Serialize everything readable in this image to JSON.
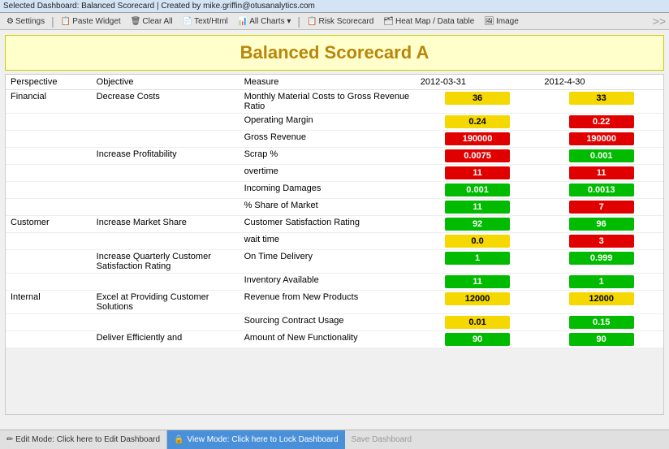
{
  "topbar": {
    "text": "Selected Dashboard: Balanced Scorecard | Created by mike.griffin@otusanalytics.com"
  },
  "toolbar": {
    "items": [
      {
        "label": "Settings",
        "icon": "⚙"
      },
      {
        "label": "Paste Widget",
        "icon": "📋"
      },
      {
        "label": "Clear All",
        "icon": "🗑"
      },
      {
        "label": "Text/Html",
        "icon": "📄"
      },
      {
        "label": "All Charts ▾",
        "icon": "📊"
      },
      {
        "label": "Risk Scorecard",
        "icon": "📋"
      },
      {
        "label": "Heat Map / Data table",
        "icon": "🗂"
      },
      {
        "label": "Image",
        "icon": "🖼"
      }
    ]
  },
  "title": "Balanced Scorecard A",
  "table": {
    "headers": [
      "Perspective",
      "Objective",
      "Measure",
      "2012-03-31",
      "2012-4-30"
    ],
    "rows": [
      {
        "perspective": "Financial",
        "objective": "Decrease Costs",
        "measure": "Monthly Material Costs to Gross Revenue Ratio",
        "val1": "36",
        "color1": "yellow",
        "val2": "33",
        "color2": "yellow"
      },
      {
        "perspective": "",
        "objective": "",
        "measure": "Operating Margin",
        "val1": "0.24",
        "color1": "yellow",
        "val2": "0.22",
        "color2": "red"
      },
      {
        "perspective": "",
        "objective": "",
        "measure": "Gross Revenue",
        "val1": "190000",
        "color1": "red",
        "val2": "190000",
        "color2": "red"
      },
      {
        "perspective": "",
        "objective": "Increase Profitability",
        "measure": "Scrap %",
        "val1": "0.0075",
        "color1": "red",
        "val2": "0.001",
        "color2": "green"
      },
      {
        "perspective": "",
        "objective": "",
        "measure": "overtime",
        "val1": "11",
        "color1": "red",
        "val2": "11",
        "color2": "red"
      },
      {
        "perspective": "",
        "objective": "",
        "measure": "Incoming Damages",
        "val1": "0.001",
        "color1": "green",
        "val2": "0.0013",
        "color2": "green"
      },
      {
        "perspective": "",
        "objective": "",
        "measure": "% Share of Market",
        "val1": "11",
        "color1": "green",
        "val2": "7",
        "color2": "red"
      },
      {
        "perspective": "Customer",
        "objective": "Increase Market Share",
        "measure": "Customer Satisfaction Rating",
        "val1": "92",
        "color1": "green",
        "val2": "96",
        "color2": "green"
      },
      {
        "perspective": "",
        "objective": "",
        "measure": "wait time",
        "val1": "0.0",
        "color1": "yellow",
        "val2": "3",
        "color2": "red"
      },
      {
        "perspective": "",
        "objective": "Increase Quarterly Customer Satisfaction Rating",
        "measure": "On Time Delivery",
        "val1": "1",
        "color1": "green",
        "val2": "0.999",
        "color2": "green"
      },
      {
        "perspective": "",
        "objective": "",
        "measure": "Inventory Available",
        "val1": "11",
        "color1": "green",
        "val2": "1",
        "color2": "green"
      },
      {
        "perspective": "Internal",
        "objective": "Excel at Providing Customer Solutions",
        "measure": "Revenue from New Products",
        "val1": "12000",
        "color1": "yellow",
        "val2": "12000",
        "color2": "yellow"
      },
      {
        "perspective": "",
        "objective": "",
        "measure": "Sourcing Contract Usage",
        "val1": "0.01",
        "color1": "yellow",
        "val2": "0.15",
        "color2": "green"
      },
      {
        "perspective": "",
        "objective": "Deliver Efficiently and",
        "measure": "Amount of New Functionality",
        "val1": "90",
        "color1": "green",
        "val2": "90",
        "color2": "green"
      }
    ]
  },
  "bottombar": {
    "edit": "Edit Mode: Click here to Edit Dashboard",
    "view": "View Mode: Click here to Lock Dashboard",
    "save": "Save Dashboard"
  }
}
